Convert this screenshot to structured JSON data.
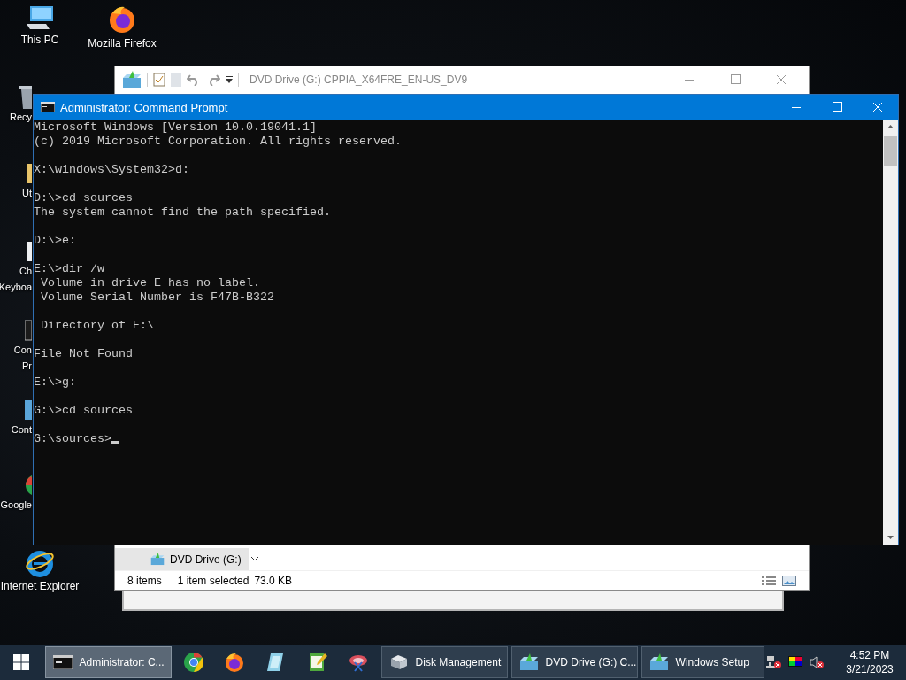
{
  "desktop_icons": [
    {
      "label": "This PC",
      "kind": "pc"
    },
    {
      "label": "Mozilla Firefox",
      "kind": "firefox"
    },
    {
      "label": "Recy",
      "kind": "bin"
    },
    {
      "label": "Ut",
      "kind": "folder"
    },
    {
      "label": "Ch",
      "kind": "doc"
    },
    {
      "label": "Keyboa",
      "kind": "none"
    },
    {
      "label": "Con",
      "kind": "cmd"
    },
    {
      "label": "Pr",
      "kind": "none"
    },
    {
      "label": "Cont",
      "kind": "panel"
    },
    {
      "label": "Google",
      "kind": "chrome"
    },
    {
      "label": "Internet Explorer",
      "kind": "ie"
    }
  ],
  "explorer": {
    "title": "DVD Drive (G:) CPPIA_X64FRE_EN-US_DV9",
    "nav_item": {
      "label": "DVD Drive (G:)",
      "selected": true
    },
    "status": {
      "items": "8 items",
      "selection": "1 item selected",
      "size": "73.0 KB"
    }
  },
  "command_prompt": {
    "title": "Administrator: Command Prompt",
    "blocks": [
      [
        "Microsoft Windows [Version 10.0.19041.1]",
        "(c) 2019 Microsoft Corporation. All rights reserved."
      ],
      [
        "X:\\windows\\System32>d:"
      ],
      [
        "D:\\>cd sources",
        "The system cannot find the path specified."
      ],
      [
        "D:\\>e:"
      ],
      [
        "E:\\>dir /w",
        " Volume in drive E has no label.",
        " Volume Serial Number is F47B-B322"
      ],
      [
        " Directory of E:\\"
      ],
      [
        "File Not Found"
      ],
      [
        "E:\\>g:"
      ],
      [
        "G:\\>cd sources"
      ]
    ],
    "prompt": "G:\\sources>"
  },
  "taskbar": {
    "items": [
      {
        "kind": "window",
        "label": "Administrator: C...",
        "selected": true
      },
      {
        "kind": "pinned"
      },
      {
        "kind": "pinned"
      },
      {
        "kind": "pinned"
      },
      {
        "kind": "pinned"
      },
      {
        "kind": "pinned"
      },
      {
        "kind": "window",
        "label": "Disk Management",
        "selected": false
      },
      {
        "kind": "window",
        "label": "DVD Drive (G:) C...",
        "selected": false
      },
      {
        "kind": "window",
        "label": "Windows Setup",
        "selected": false
      }
    ],
    "time": "4:52 PM",
    "date": "3/21/2023"
  }
}
